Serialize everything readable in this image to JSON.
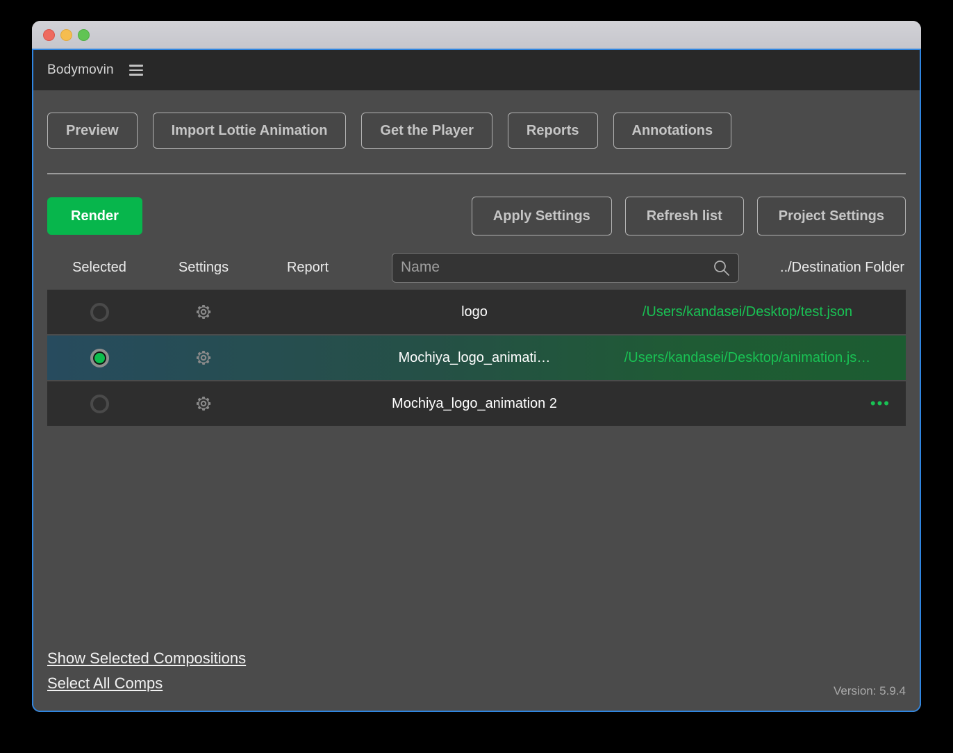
{
  "window": {
    "traffic_lights": [
      "close-button",
      "minimize-button",
      "maximize-button"
    ],
    "accent_border": "#2f85e0"
  },
  "panel": {
    "title": "Bodymovin",
    "menu_icon": "hamburger-icon"
  },
  "toolbar": {
    "buttons": [
      {
        "label": "Preview",
        "name": "preview-button"
      },
      {
        "label": "Import Lottie Animation",
        "name": "import-lottie-animation-button"
      },
      {
        "label": "Get the Player",
        "name": "get-the-player-button"
      },
      {
        "label": "Reports",
        "name": "reports-button"
      },
      {
        "label": "Annotations",
        "name": "annotations-button"
      }
    ]
  },
  "actions": {
    "render_label": "Render",
    "render_color": "#07b64c",
    "apply_settings_label": "Apply Settings",
    "refresh_list_label": "Refresh list",
    "project_settings_label": "Project Settings"
  },
  "table": {
    "headers": {
      "selected": "Selected",
      "settings": "Settings",
      "report": "Report",
      "destination": "../Destination Folder"
    },
    "search": {
      "placeholder": "Name",
      "value": "",
      "icon": "search-icon"
    },
    "rows": [
      {
        "selected": false,
        "name": "logo",
        "destination": "/Users/kandasei/Desktop/test.json",
        "destination_is_ellipsis": false
      },
      {
        "selected": true,
        "name": "Mochiya_logo_animati…",
        "destination": "/Users/kandasei/Desktop/animation.js…",
        "destination_is_ellipsis": false
      },
      {
        "selected": false,
        "name": "Mochiya_logo_animation 2",
        "destination": "•••",
        "destination_is_ellipsis": true
      }
    ]
  },
  "footer": {
    "show_selected_compositions": "Show Selected Compositions",
    "select_all_comps": "Select All Comps",
    "version": "Version: 5.9.4"
  }
}
